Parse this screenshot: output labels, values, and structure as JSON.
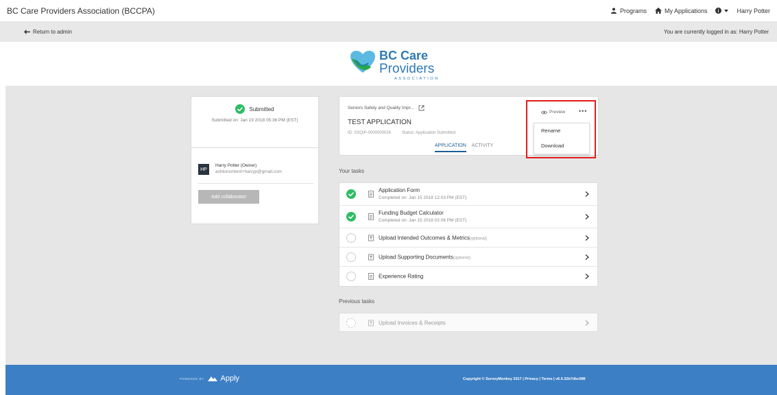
{
  "topbar": {
    "brand": "BC Care Providers Association (BCCPA)",
    "nav": {
      "programs": "Programs",
      "my_applications": "My Applications",
      "user": "Harry Potter"
    }
  },
  "adminbar": {
    "return": "Return to admin",
    "logged_in": "You are currently logged in as: Harry Potter"
  },
  "logo": {
    "line1": "BC Care",
    "line2": "Providers",
    "line3": "ASSOCIATION"
  },
  "status_card": {
    "status": "Submitted",
    "submitted_on": "Submitted on: Jan 19 2018 05:36 PM (EST)",
    "owner_initials": "HP",
    "owner_name": "Harry Potter (Owner)",
    "owner_email": "ashtonsmtest+harryp@gmail.com",
    "add_collaborator": "Add collaborator"
  },
  "application": {
    "program": "Seniors Safety and Quality Impr...",
    "title": "TEST APPLICATION",
    "id": "ID: SSQIP-0000000026",
    "status": "Status: Application Submitted",
    "tabs": [
      "APPLICATION",
      "ACTIVITY"
    ],
    "preview": "Preview",
    "more": "•••",
    "menu": [
      "Rename",
      "Download"
    ]
  },
  "your_tasks_label": "Your tasks",
  "tasks": [
    {
      "name": "Application Form",
      "sub": "Completed on: Jan 15 2018 12:03 PM (EST)",
      "optional": "",
      "done": true
    },
    {
      "name": "Funding Budget Calculator",
      "sub": "Completed on: Jan 15 2018 02:06 PM (EST)",
      "optional": "",
      "done": true
    },
    {
      "name": "Upload Intended Outcomes & Metrics",
      "sub": "",
      "optional": "(optional)",
      "done": false
    },
    {
      "name": "Upload Supporting Documents",
      "sub": "",
      "optional": "(optional)",
      "done": false
    },
    {
      "name": "Experience Rating",
      "sub": "",
      "optional": "",
      "done": false
    }
  ],
  "previous_tasks_label": "Previous tasks",
  "previous_tasks": [
    {
      "name": "Upload Invoices & Receipts"
    }
  ],
  "footer": {
    "powered_by": "POWERED BY",
    "apply": "Apply",
    "copyright": "Copyright © SurveyMonkey 2017 | Privacy | Terms | v6.0.32b7dbc986"
  },
  "colors": {
    "accent": "#1d5d96",
    "success": "#2ebd63",
    "footer": "#3d7fc4",
    "highlight": "#e21b1b"
  }
}
